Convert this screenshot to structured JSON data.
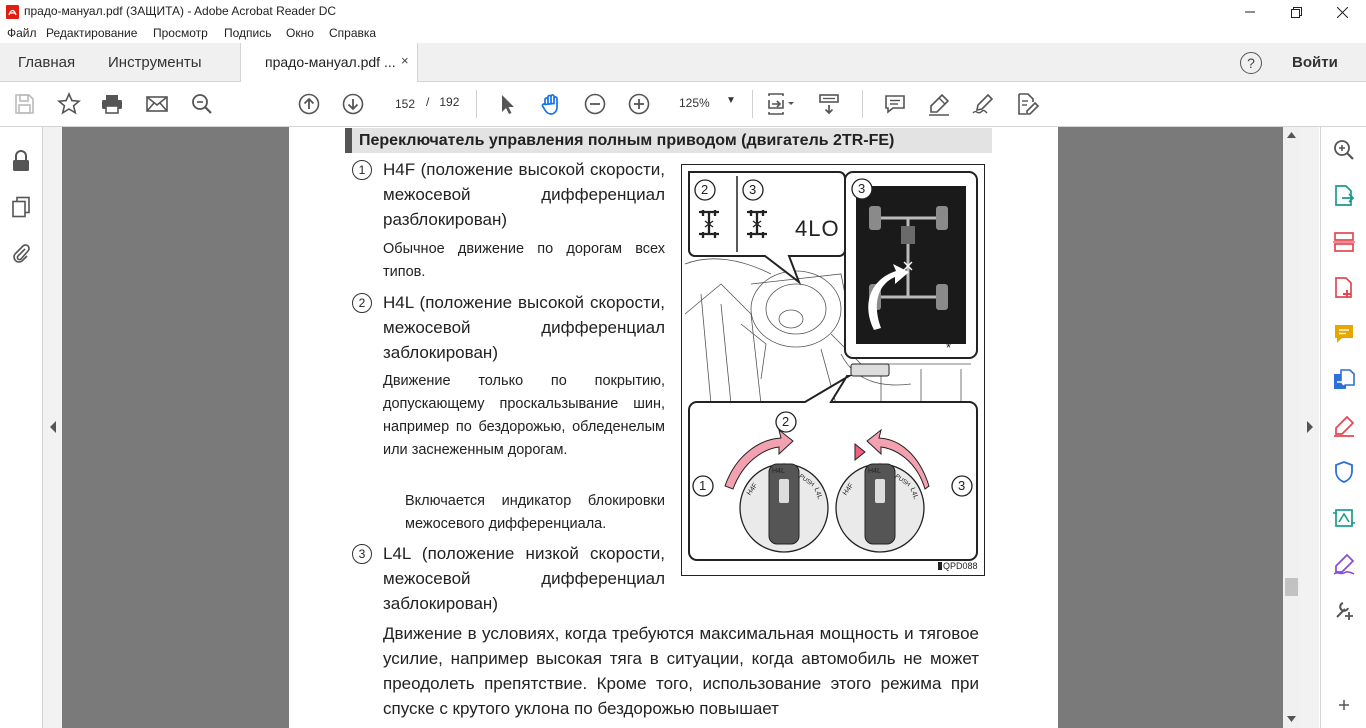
{
  "window": {
    "title": "прадо-мануал.pdf (ЗАЩИТА) - Adobe Acrobat Reader DC"
  },
  "menu": [
    "Файл",
    "Редактирование",
    "Просмотр",
    "Подпись",
    "Окно",
    "Справка"
  ],
  "tabs": {
    "home": "Главная",
    "tools": "Инструменты",
    "document": "прадо-мануал.pdf ...",
    "close": "×",
    "help": "?",
    "signin": "Войти"
  },
  "toolbar": {
    "page_current": "152",
    "page_separator": "/",
    "page_total": "192",
    "zoom": "125%"
  },
  "colors": {
    "accent": "#1473e6",
    "right_tool_red": "#e34850",
    "right_tool_yellow": "#e8a600",
    "right_tool_blue": "#2d6fdb",
    "right_tool_purple": "#8a4ad1",
    "right_tool_teal": "#1a9b8e",
    "viewer_bg": "#7a7a7a",
    "heading_bg": "#e3e3e3"
  },
  "document": {
    "heading": "Переключатель управления полным приводом (двигатель 2TR-FE)",
    "items": [
      {
        "num": "1",
        "title": "H4F (положение высокой скорости, межосевой дифференциал разблокирован)",
        "text": "Обычное движение по дорогам всех типов."
      },
      {
        "num": "2",
        "title": "H4L (положение высокой скорости, межосевой дифференциал заблокирован)",
        "text": "Движение только по покрытию, допускающему проскальзывание шин, например по бездорожью, обледенелым или заснеженным дорогам.",
        "note": "Включается индикатор блокировки межосевого дифференциала."
      },
      {
        "num": "3",
        "title": "L4L (положение низкой скорости, межосевой дифференциал заблокирован)"
      }
    ],
    "paragraph": "Движение в условиях, когда требуются максимальная мощность и тяговое усилие, например высокая тяга в ситуации, когда автомобиль не может преодолеть препятствие. Кроме того, использование этого режима при спуске с крутого уклона по бездорожью повышает",
    "figure": {
      "label_4lo": "4LO",
      "callout_2": "2",
      "callout_3": "3",
      "knob_h4l": "H4L",
      "knob_h4f": "H4F",
      "knob_push": "PUSH",
      "knob_l4l": "L4L",
      "star": "*",
      "code": "QPD088"
    }
  },
  "icons": {
    "left": [
      "lock-icon",
      "pages-icon",
      "paperclip-icon"
    ],
    "right": [
      "zoom-in-icon",
      "export-pdf-icon",
      "organize-pages-icon",
      "create-pdf-icon",
      "comment-icon",
      "combine-files-icon",
      "fill-sign-icon",
      "protect-icon",
      "send-for-review-icon",
      "request-signature-icon",
      "more-tools-icon"
    ]
  }
}
